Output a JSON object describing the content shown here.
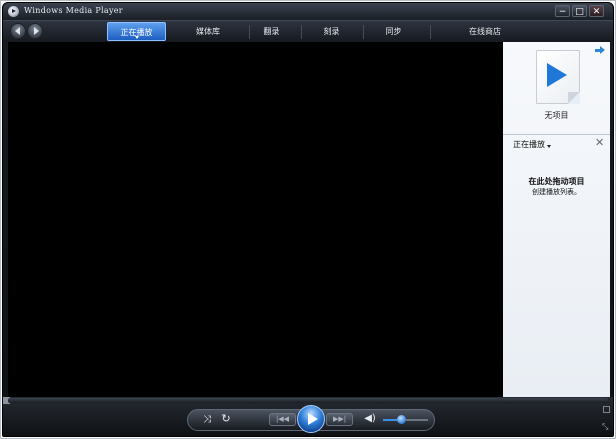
{
  "window": {
    "title": "Windows Media Player",
    "minimize_glyph": "−",
    "maximize_glyph": "□",
    "close_glyph": "✕"
  },
  "nav": {
    "tabs": [
      {
        "label": "正在播放",
        "active": true
      },
      {
        "label": "媒体库"
      },
      {
        "label": "翻录"
      },
      {
        "label": "刻录"
      },
      {
        "label": "同步"
      },
      {
        "label": "在线商店"
      }
    ]
  },
  "pane": {
    "no_items": "无项目",
    "now_playing": "正在播放",
    "drag_here": "在此处拖动项目",
    "create_playlist": "创建播放列表。",
    "close_glyph": "✕"
  },
  "controls": {
    "shuffle_glyph": "⤨",
    "repeat_glyph": "↻",
    "prev_glyph": "|◀◀",
    "next_glyph": "▶▶|",
    "mute_glyph": "◀)",
    "resize_glyph": "⤡",
    "volume_fraction": 0.4,
    "accent": "#2f7ed8"
  },
  "icons": {
    "app": "media-player-icon",
    "back": "back-arrow-icon",
    "forward": "forward-arrow-icon",
    "shuffle": "shuffle-icon",
    "repeat": "repeat-icon",
    "stop": "stop-icon",
    "previous": "previous-icon",
    "play": "play-icon",
    "next": "next-icon",
    "mute": "speaker-icon",
    "pane_options": "arrow-right-icon",
    "pane_close": "close-icon"
  }
}
